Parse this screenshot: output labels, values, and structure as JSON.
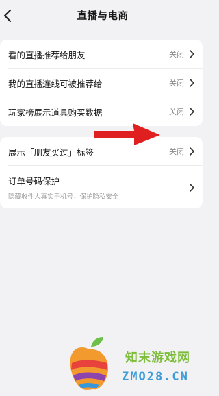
{
  "header": {
    "title": "直播与电商"
  },
  "group1": {
    "items": [
      {
        "label": "看的直播推荐给朋友",
        "value": "关闭"
      },
      {
        "label": "我的直播连线可被推荐给",
        "value": "关闭"
      },
      {
        "label": "玩家榜展示道具购买数据",
        "value": "关闭"
      }
    ]
  },
  "group2": {
    "items": [
      {
        "label": "展示「朋友买过」标签",
        "value": "关闭"
      },
      {
        "label": "订单号码保护",
        "desc": "隐藏收件人真实手机号，保护隐私安全"
      }
    ]
  },
  "watermark": {
    "name": "知末游戏网",
    "domain": "ZMO28.CN"
  },
  "colors": {
    "arrow": "#e02020",
    "brand_green": "#7dbd3a",
    "brand_blue": "#3c9bd8"
  }
}
